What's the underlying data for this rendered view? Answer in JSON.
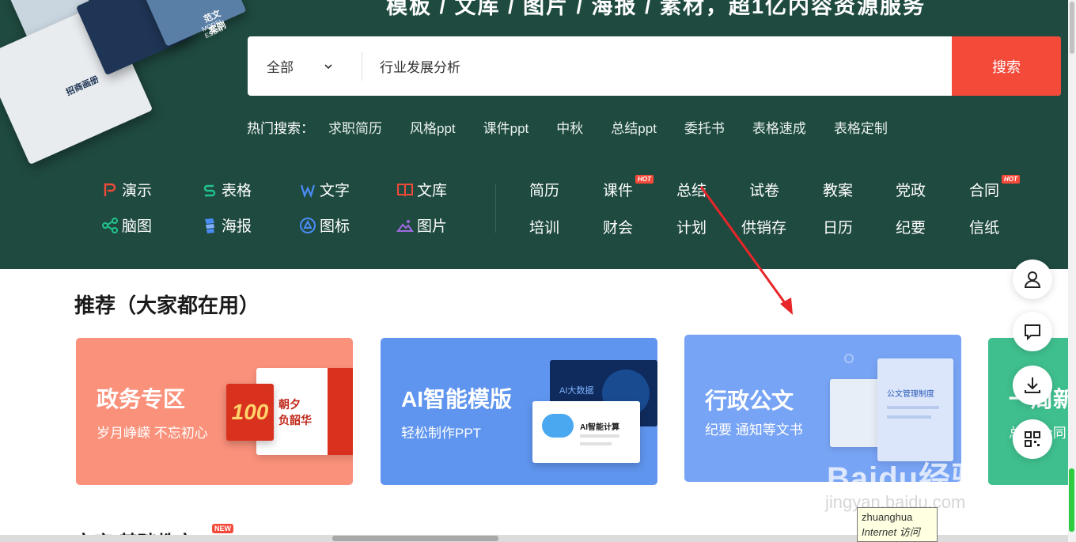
{
  "banner": {
    "slogan": "模板 / 文库 / 图片 / 海报 / 素材，超1亿内容资源服务",
    "deco_texts": [
      "范文案例",
      "MODEL ESSAY",
      "招商画册"
    ]
  },
  "search": {
    "category": "全部",
    "query": "行业发展分析",
    "button": "搜索"
  },
  "hot": {
    "label": "热门搜索：",
    "keywords": [
      "求职简历",
      "风格ppt",
      "课件ppt",
      "中秋",
      "总结ppt",
      "委托书",
      "表格速成",
      "表格定制"
    ]
  },
  "apps": [
    {
      "label": "演示",
      "icon": "presentation-p-icon",
      "color": "#f34a3a"
    },
    {
      "label": "表格",
      "icon": "sheet-s-icon",
      "color": "#21c48e"
    },
    {
      "label": "文字",
      "icon": "writer-w-icon",
      "color": "#4a8cf6"
    },
    {
      "label": "文库",
      "icon": "book-icon",
      "color": "#f34a3a"
    },
    {
      "label": "脑图",
      "icon": "mindmap-icon",
      "color": "#21c48e"
    },
    {
      "label": "海报",
      "icon": "poster-icon",
      "color": "#4a8cf6"
    },
    {
      "label": "图标",
      "icon": "icon-circle-icon",
      "color": "#4a8cf6"
    },
    {
      "label": "图片",
      "icon": "image-icon",
      "color": "#a06ae0"
    }
  ],
  "categories": {
    "row1": [
      "简历",
      "课件",
      "总结",
      "试卷",
      "教案",
      "党政",
      "合同"
    ],
    "row2": [
      "培训",
      "财会",
      "计划",
      "供销存",
      "日历",
      "纪要",
      "信纸"
    ],
    "hot_badge": "HOT"
  },
  "recommend": {
    "title": "推荐（大家都在用）",
    "cards": [
      {
        "title": "政务专区",
        "subtitle": "岁月峥嵘 不忘初心",
        "image_text": "朝夕",
        "image_text2": "负韶华"
      },
      {
        "title": "AI智能模版",
        "subtitle": "轻松制作PPT",
        "image_text": "AI大数据",
        "image_text2": "AI智能计算"
      },
      {
        "title": "行政公文",
        "subtitle": "纪要 通知等文书",
        "image_text": "公文管理制度"
      },
      {
        "title": "一周新",
        "subtitle": "总结 合同"
      }
    ]
  },
  "next_section": {
    "title": "文库·基础教育",
    "badge": "NEW"
  },
  "tooltip": {
    "line1": "zhuanghua",
    "line2": "Internet 访问"
  },
  "watermark": {
    "main": "Baidu经验",
    "sub": "jingyan.baidu.com"
  },
  "float_buttons": [
    "user-icon",
    "chat-icon",
    "download-icon",
    "qrcode-icon"
  ]
}
